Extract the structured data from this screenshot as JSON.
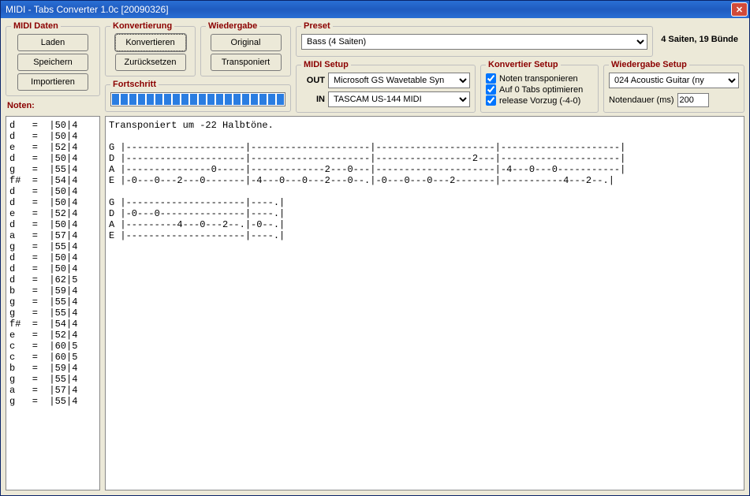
{
  "window": {
    "title": "MIDI - Tabs Converter 1.0c [20090326]"
  },
  "groups": {
    "midi_daten": "MIDI Daten",
    "konvertierung": "Konvertierung",
    "wiedergabe": "Wiedergabe",
    "preset": "Preset",
    "fortschritt": "Fortschritt",
    "midi_setup": "MIDI Setup",
    "konvertier_setup": "Konvertier Setup",
    "wiedergabe_setup": "Wiedergabe Setup"
  },
  "buttons": {
    "laden": "Laden",
    "speichern": "Speichern",
    "importieren": "Importieren",
    "konvertieren": "Konvertieren",
    "zuruecksetzen": "Zurücksetzen",
    "original": "Original",
    "transponiert": "Transponiert"
  },
  "labels": {
    "noten": "Noten:",
    "out": "OUT",
    "in": "IN",
    "notendauer": "Notendauer (ms)"
  },
  "preset": {
    "selected": "Bass (4 Saiten)",
    "info": "4 Saiten, 19 Bünde"
  },
  "midi_setup": {
    "out": "Microsoft GS Wavetable Syn",
    "in": "TASCAM US-144 MIDI"
  },
  "konvertier_setup": {
    "transponieren": "Noten transponieren",
    "optimieren": "Auf 0 Tabs optimieren",
    "vorzug": "release Vorzug (-4-0)"
  },
  "wiedergabe_setup": {
    "instrument": "024 Acoustic Guitar (ny",
    "notendauer_value": "200"
  },
  "notes_pane": "d   =  |50|4\nd   =  |50|4\ne   =  |52|4\nd   =  |50|4\ng   =  |55|4\nf#  =  |54|4\nd   =  |50|4\nd   =  |50|4\ne   =  |52|4\nd   =  |50|4\na   =  |57|4\ng   =  |55|4\nd   =  |50|4\nd   =  |50|4\nd   =  |62|5\nb   =  |59|4\ng   =  |55|4\ng   =  |55|4\nf#  =  |54|4\ne   =  |52|4\nc   =  |60|5\nc   =  |60|5\nb   =  |59|4\ng   =  |55|4\na   =  |57|4\ng   =  |55|4",
  "tabs_pane": "Transponiert um -22 Halbtöne.\n\nG |---------------------|---------------------|---------------------|---------------------|\nD |---------------------|---------------------|-----------------2---|---------------------|\nA |---------------0-----|-------------2---0---|---------------------|-4---0---0-----------|\nE |-0---0---2---0-------|-4---0---0---2---0--.|-0---0---0---2-------|-----------4---2--.|\n\nG |---------------------|----.|\nD |-0---0---------------|----.|\nA |---------4---0---2--.|-0--.|\nE |---------------------|----.|"
}
